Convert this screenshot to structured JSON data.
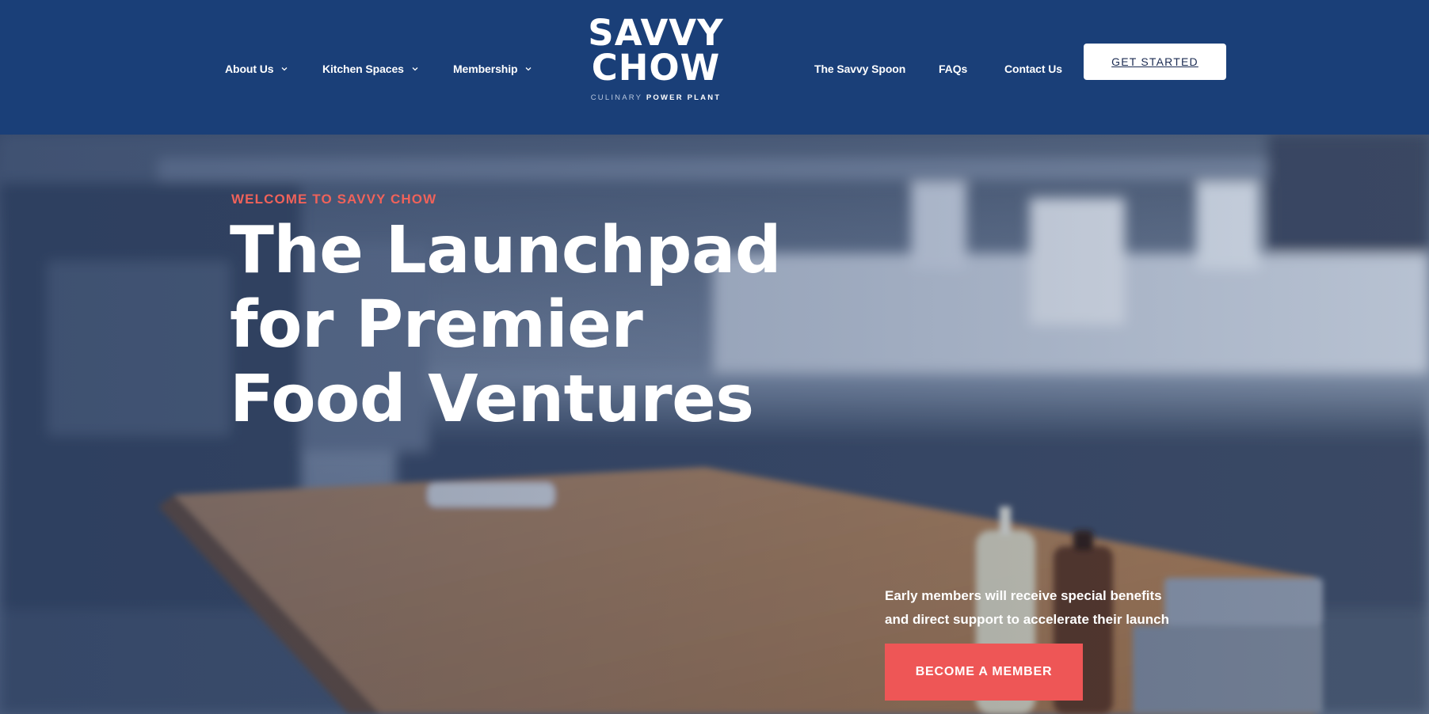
{
  "header": {
    "nav_left": [
      {
        "label": "About Us",
        "has_dropdown": true,
        "icon": "chevron-down-icon"
      },
      {
        "label": "Kitchen Spaces",
        "has_dropdown": true,
        "icon": "chevron-down-icon"
      },
      {
        "label": "Membership",
        "has_dropdown": true,
        "icon": "chevron-down-icon"
      }
    ],
    "logo": {
      "line1": "SAVVY",
      "line2": "CHOW",
      "sub_culinary": "CULINARY",
      "sub_power": "POWER PLANT"
    },
    "nav_right": [
      {
        "label": "The Savvy Spoon"
      },
      {
        "label": "FAQs"
      },
      {
        "label": "Contact Us"
      }
    ],
    "cta_label": "GET STARTED"
  },
  "hero": {
    "eyebrow": "WELCOME TO SAVVY CHOW",
    "headline_lines": [
      "The Launchpad",
      "for Premier",
      "Food Ventures"
    ],
    "benefit_lines": [
      "Early members will receive special benefits",
      "and direct support to accelerate their launch"
    ],
    "cta_label": "BECOME A MEMBER"
  },
  "colors": {
    "header_bg": "#1a3f78",
    "accent_red": "#ee5656",
    "eyebrow_red": "#f0625a",
    "white": "#ffffff"
  }
}
